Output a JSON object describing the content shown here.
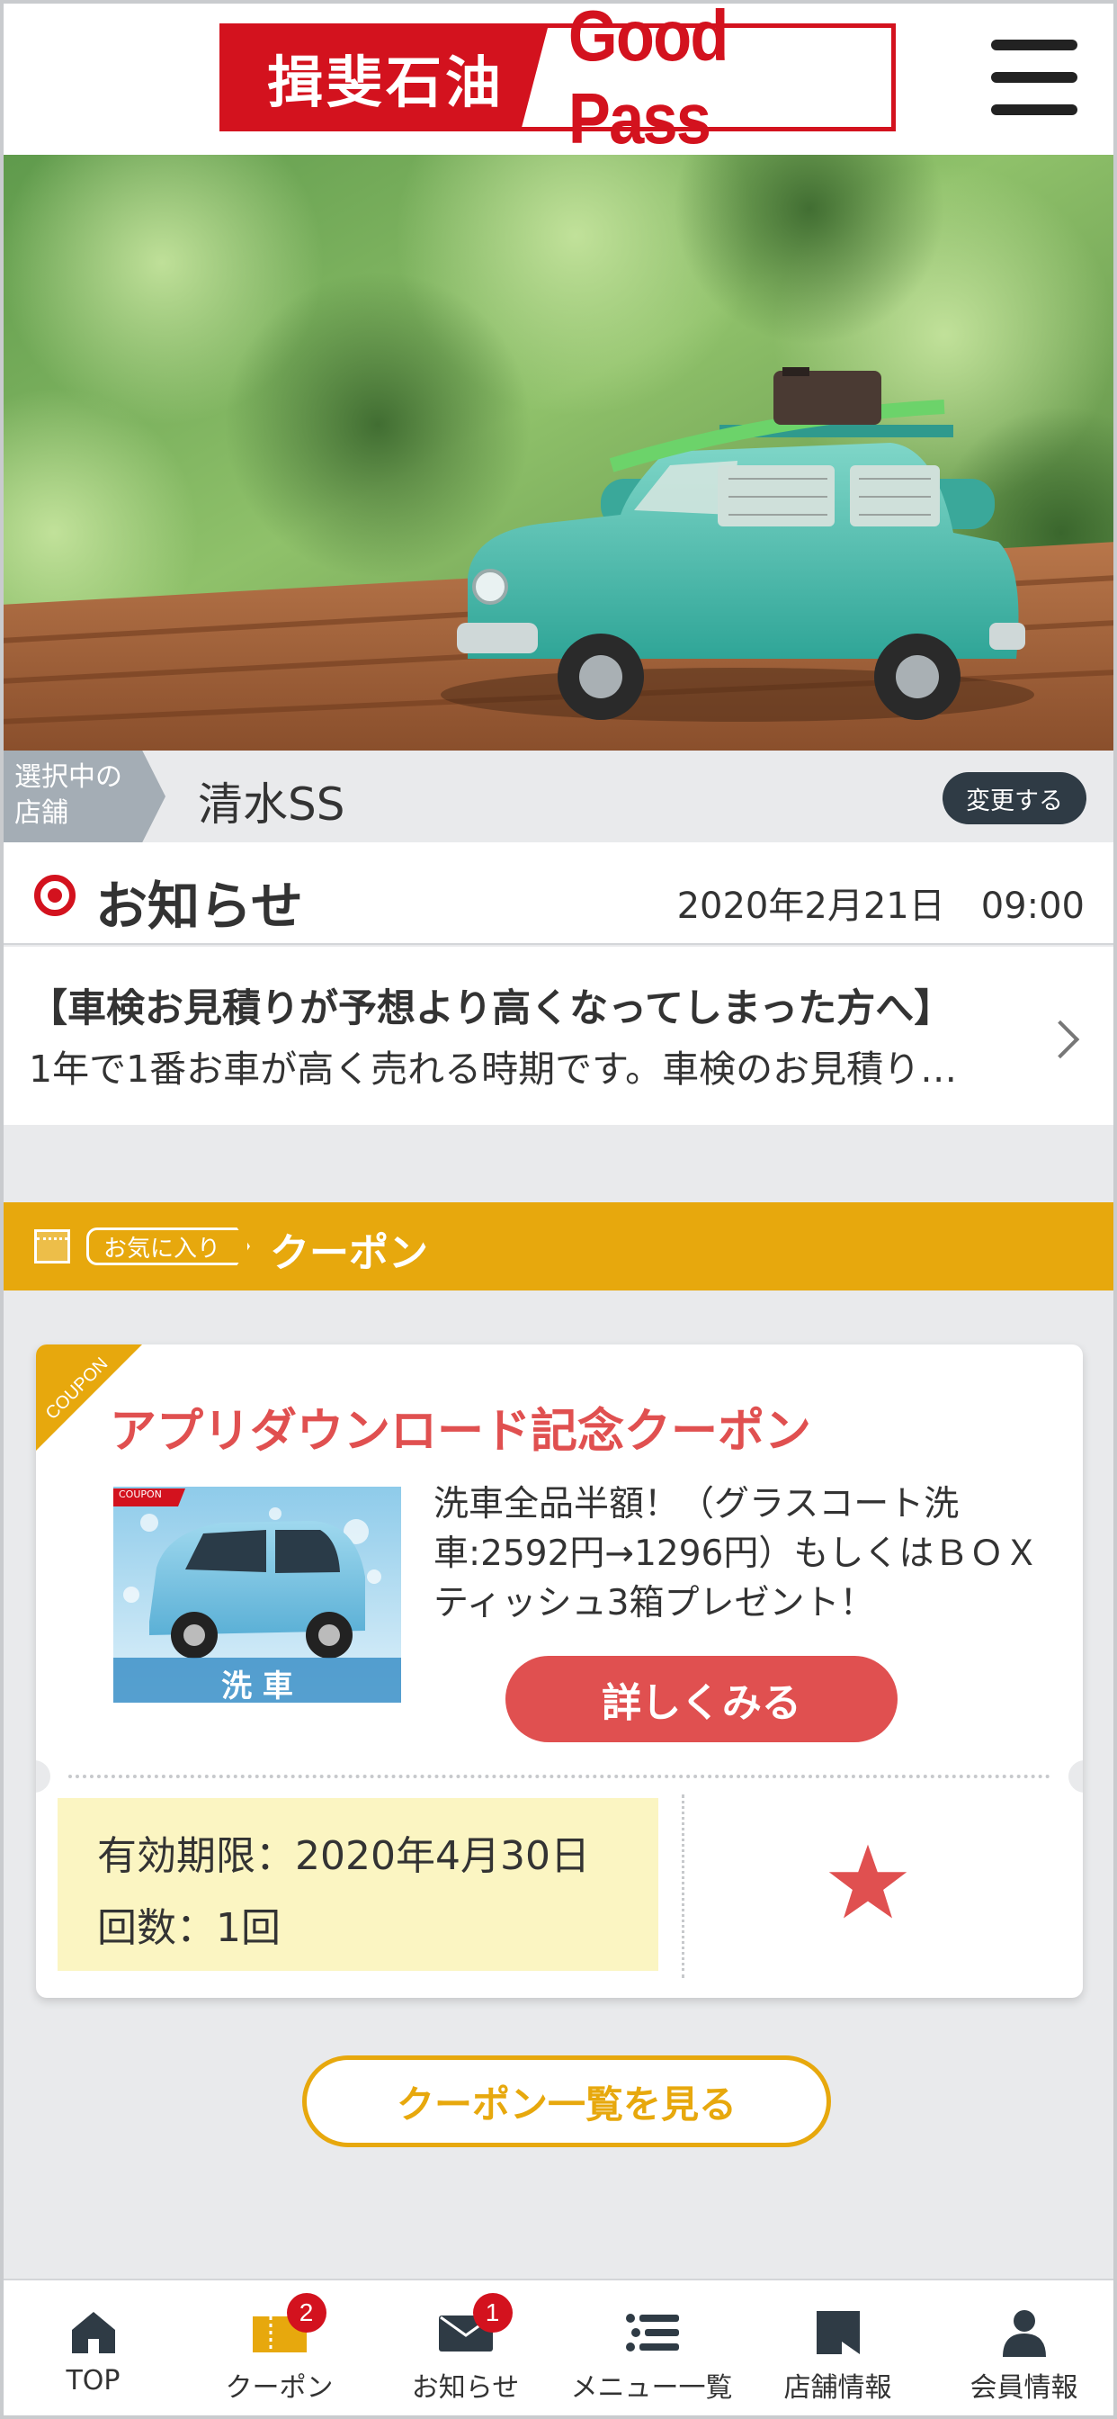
{
  "header": {
    "logo_jp": "揖斐石油",
    "logo_en": "Good Pass"
  },
  "store": {
    "tag_line1": "選択中の",
    "tag_line2": "店舗",
    "name": "清水SS",
    "change_label": "変更する"
  },
  "notice": {
    "title": "お知らせ",
    "date": "2020年2月21日　09:00",
    "headline": "【車検お見積りが予想より高くなってしまった方へ】",
    "summary": "1年で1番お車が高く売れる時期です。車検のお見積り…"
  },
  "coupon_section": {
    "favorite_tag": "お気に入り",
    "label": "クーポン"
  },
  "coupon_card": {
    "corner_label": "COUPON",
    "title": "アプリダウンロード記念クーポン",
    "image_badge": "COUPON",
    "image_caption": "洗 車",
    "description": "洗車全品半額！（グラスコート洗車:2592円→1296円）もしくはＢＯＸティッシュ3箱プレゼント！",
    "detail_button": "詳しくみる",
    "expiry": "有効期限：2020年4月30日",
    "count": "回数：1回",
    "favorite_icon": "star-icon"
  },
  "coupon_list_button": "クーポン一覧を見る",
  "tabbar": {
    "items": [
      {
        "label": "TOP",
        "icon": "home-icon"
      },
      {
        "label": "クーポン",
        "icon": "coupon-icon",
        "badge": "2"
      },
      {
        "label": "お知らせ",
        "icon": "mail-icon",
        "badge": "1"
      },
      {
        "label": "メニュー一覧",
        "icon": "list-icon"
      },
      {
        "label": "店舗情報",
        "icon": "store-icon"
      },
      {
        "label": "会員情報",
        "icon": "person-icon"
      }
    ]
  },
  "colors": {
    "brand_red": "#d3121e",
    "coupon_yellow": "#e7a80d",
    "accent_red": "#e05050",
    "dark": "#2f3b45"
  }
}
